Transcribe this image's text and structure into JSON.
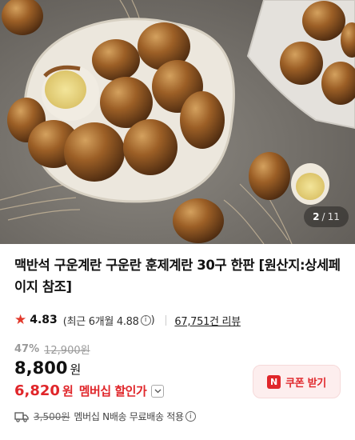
{
  "hero": {
    "image_name": "smoked-eggs-product-photo",
    "pager": {
      "current": "2",
      "separator": "/",
      "total": "11"
    }
  },
  "product": {
    "title": "맥반석 구운계란 구운란 훈제계란 30구 한판 [원산지:상세페이지 참조]"
  },
  "rating": {
    "star_icon": "star-icon",
    "value": "4.83",
    "recent_text": "(최근 6개월 4.88",
    "recent_close": ")",
    "info_icon": "ⓘ",
    "reviews_link": "67,751건 리뷰"
  },
  "price": {
    "discount_pct": "47%",
    "original_price": "12,900원",
    "sale_price": "8,800",
    "currency": "원",
    "member_price": "6,820",
    "member_currency": "원",
    "member_label": "멤버십 할인가",
    "expand_icon": "chevron-down-icon"
  },
  "coupon": {
    "badge": "N",
    "label": "쿠폰 받기"
  },
  "shipping": {
    "icon": "truck-icon",
    "original_fee": "3,500원",
    "text": "멤버십 N배송 무료배송 적용"
  },
  "colors": {
    "accent_red": "#e0262a",
    "star": "#e23a2c",
    "coupon_bg": "#fdeeee",
    "muted": "#9a9a9a"
  }
}
